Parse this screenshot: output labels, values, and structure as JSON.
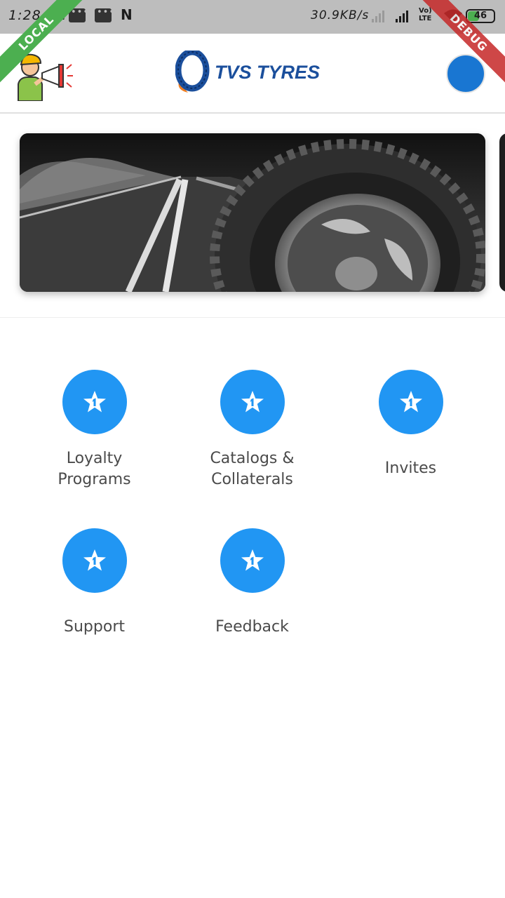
{
  "status_bar": {
    "time": "1:28 PM",
    "network_speed": "30.9KB/s",
    "network_type": [
      "Vo)",
      "LTE"
    ],
    "battery_level": "46",
    "icons": [
      "message-icon",
      "message-icon",
      "n-notification-icon",
      "signal-icon",
      "wifi-icon",
      "battery-icon"
    ]
  },
  "ribbons": {
    "left": "LOCAL",
    "right": "DEBUG"
  },
  "header": {
    "brand_name": "TVS TYRES",
    "brand_color": "#1b4f9c",
    "brand_accent": "#f07f22",
    "avatar_color": "#1976d2"
  },
  "menu": {
    "accent_color": "#2196f3",
    "items": [
      {
        "label": "Loyalty Programs",
        "icon": "star-icon"
      },
      {
        "label": "Catalogs & Collaterals",
        "icon": "star-icon"
      },
      {
        "label": "Invites",
        "icon": "star-icon"
      },
      {
        "label": "Support",
        "icon": "star-icon"
      },
      {
        "label": "Feedback",
        "icon": "star-icon"
      }
    ]
  }
}
